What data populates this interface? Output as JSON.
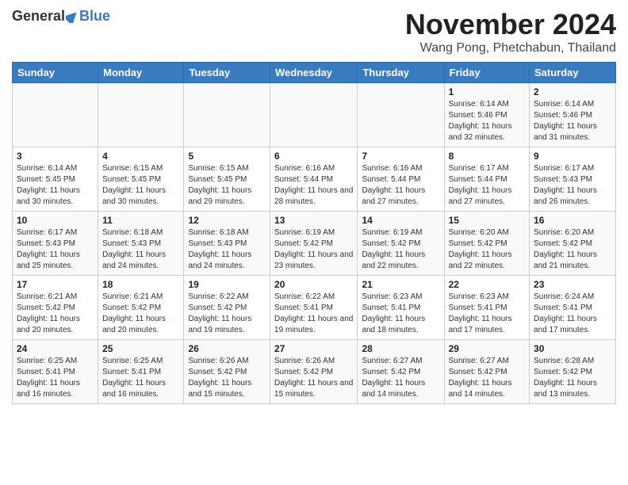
{
  "header": {
    "logo": {
      "general": "General",
      "blue": "Blue"
    },
    "title": "November 2024",
    "subtitle": "Wang Pong, Phetchabun, Thailand"
  },
  "days_of_week": [
    "Sunday",
    "Monday",
    "Tuesday",
    "Wednesday",
    "Thursday",
    "Friday",
    "Saturday"
  ],
  "weeks": [
    [
      {
        "day": "",
        "info": ""
      },
      {
        "day": "",
        "info": ""
      },
      {
        "day": "",
        "info": ""
      },
      {
        "day": "",
        "info": ""
      },
      {
        "day": "",
        "info": ""
      },
      {
        "day": "1",
        "info": "Sunrise: 6:14 AM\nSunset: 5:46 PM\nDaylight: 11 hours and 32 minutes."
      },
      {
        "day": "2",
        "info": "Sunrise: 6:14 AM\nSunset: 5:46 PM\nDaylight: 11 hours and 31 minutes."
      }
    ],
    [
      {
        "day": "3",
        "info": "Sunrise: 6:14 AM\nSunset: 5:45 PM\nDaylight: 11 hours and 30 minutes."
      },
      {
        "day": "4",
        "info": "Sunrise: 6:15 AM\nSunset: 5:45 PM\nDaylight: 11 hours and 30 minutes."
      },
      {
        "day": "5",
        "info": "Sunrise: 6:15 AM\nSunset: 5:45 PM\nDaylight: 11 hours and 29 minutes."
      },
      {
        "day": "6",
        "info": "Sunrise: 6:16 AM\nSunset: 5:44 PM\nDaylight: 11 hours and 28 minutes."
      },
      {
        "day": "7",
        "info": "Sunrise: 6:16 AM\nSunset: 5:44 PM\nDaylight: 11 hours and 27 minutes."
      },
      {
        "day": "8",
        "info": "Sunrise: 6:17 AM\nSunset: 5:44 PM\nDaylight: 11 hours and 27 minutes."
      },
      {
        "day": "9",
        "info": "Sunrise: 6:17 AM\nSunset: 5:43 PM\nDaylight: 11 hours and 26 minutes."
      }
    ],
    [
      {
        "day": "10",
        "info": "Sunrise: 6:17 AM\nSunset: 5:43 PM\nDaylight: 11 hours and 25 minutes."
      },
      {
        "day": "11",
        "info": "Sunrise: 6:18 AM\nSunset: 5:43 PM\nDaylight: 11 hours and 24 minutes."
      },
      {
        "day": "12",
        "info": "Sunrise: 6:18 AM\nSunset: 5:43 PM\nDaylight: 11 hours and 24 minutes."
      },
      {
        "day": "13",
        "info": "Sunrise: 6:19 AM\nSunset: 5:42 PM\nDaylight: 11 hours and 23 minutes."
      },
      {
        "day": "14",
        "info": "Sunrise: 6:19 AM\nSunset: 5:42 PM\nDaylight: 11 hours and 22 minutes."
      },
      {
        "day": "15",
        "info": "Sunrise: 6:20 AM\nSunset: 5:42 PM\nDaylight: 11 hours and 22 minutes."
      },
      {
        "day": "16",
        "info": "Sunrise: 6:20 AM\nSunset: 5:42 PM\nDaylight: 11 hours and 21 minutes."
      }
    ],
    [
      {
        "day": "17",
        "info": "Sunrise: 6:21 AM\nSunset: 5:42 PM\nDaylight: 11 hours and 20 minutes."
      },
      {
        "day": "18",
        "info": "Sunrise: 6:21 AM\nSunset: 5:42 PM\nDaylight: 11 hours and 20 minutes."
      },
      {
        "day": "19",
        "info": "Sunrise: 6:22 AM\nSunset: 5:42 PM\nDaylight: 11 hours and 19 minutes."
      },
      {
        "day": "20",
        "info": "Sunrise: 6:22 AM\nSunset: 5:41 PM\nDaylight: 11 hours and 19 minutes."
      },
      {
        "day": "21",
        "info": "Sunrise: 6:23 AM\nSunset: 5:41 PM\nDaylight: 11 hours and 18 minutes."
      },
      {
        "day": "22",
        "info": "Sunrise: 6:23 AM\nSunset: 5:41 PM\nDaylight: 11 hours and 17 minutes."
      },
      {
        "day": "23",
        "info": "Sunrise: 6:24 AM\nSunset: 5:41 PM\nDaylight: 11 hours and 17 minutes."
      }
    ],
    [
      {
        "day": "24",
        "info": "Sunrise: 6:25 AM\nSunset: 5:41 PM\nDaylight: 11 hours and 16 minutes."
      },
      {
        "day": "25",
        "info": "Sunrise: 6:25 AM\nSunset: 5:41 PM\nDaylight: 11 hours and 16 minutes."
      },
      {
        "day": "26",
        "info": "Sunrise: 6:26 AM\nSunset: 5:42 PM\nDaylight: 11 hours and 15 minutes."
      },
      {
        "day": "27",
        "info": "Sunrise: 6:26 AM\nSunset: 5:42 PM\nDaylight: 11 hours and 15 minutes."
      },
      {
        "day": "28",
        "info": "Sunrise: 6:27 AM\nSunset: 5:42 PM\nDaylight: 11 hours and 14 minutes."
      },
      {
        "day": "29",
        "info": "Sunrise: 6:27 AM\nSunset: 5:42 PM\nDaylight: 11 hours and 14 minutes."
      },
      {
        "day": "30",
        "info": "Sunrise: 6:28 AM\nSunset: 5:42 PM\nDaylight: 11 hours and 13 minutes."
      }
    ]
  ]
}
